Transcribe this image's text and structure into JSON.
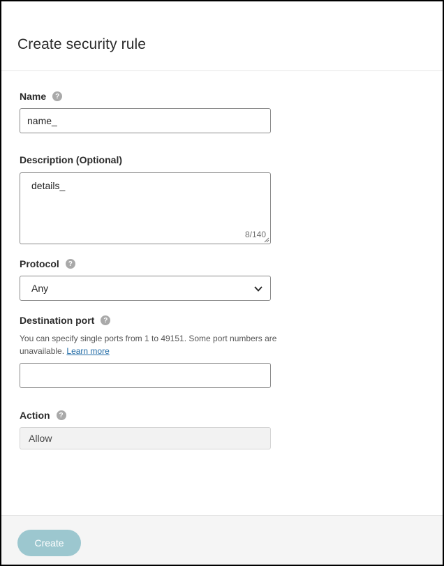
{
  "dialog": {
    "title": "Create security rule"
  },
  "form": {
    "name": {
      "label": "Name",
      "value": "name_"
    },
    "description": {
      "label": "Description (Optional)",
      "value": "details_",
      "counter": "8/140"
    },
    "protocol": {
      "label": "Protocol",
      "selected": "Any"
    },
    "destination_port": {
      "label": "Destination port",
      "hint": "You can specify single ports from 1 to 49151. Some port numbers are unavailable.",
      "learn_more": "Learn more",
      "value": ""
    },
    "action": {
      "label": "Action",
      "value": "Allow"
    },
    "help_glyph": "?"
  },
  "footer": {
    "create_label": "Create"
  },
  "colors": {
    "create_button": "#9cc7cf",
    "help_icon": "#a9a9a9",
    "link": "#1f6aa5"
  }
}
